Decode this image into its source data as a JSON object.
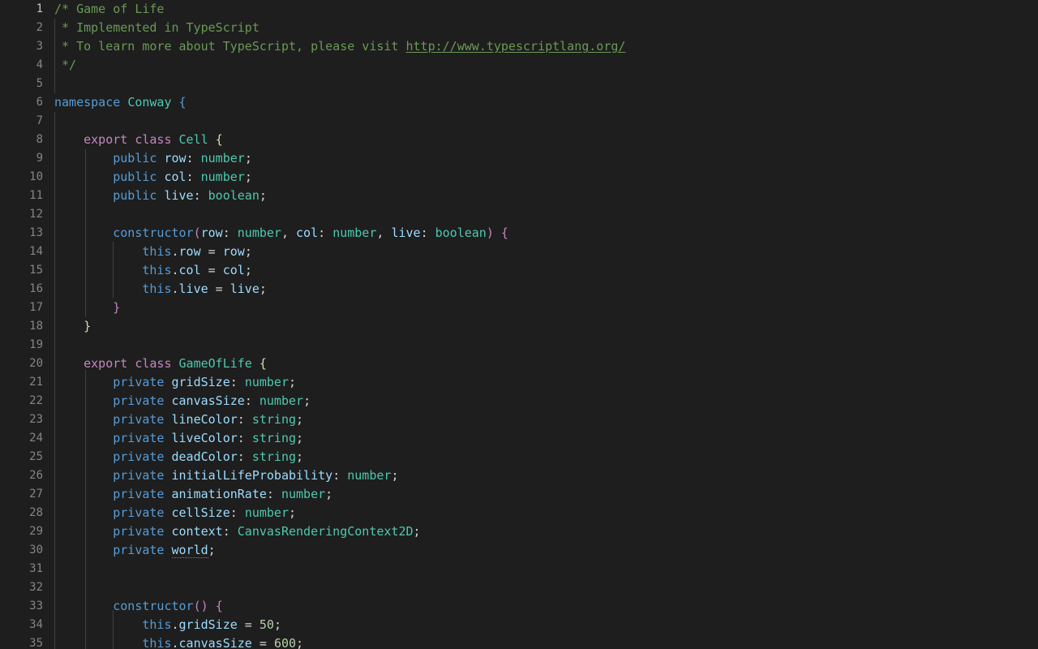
{
  "editor": {
    "language": "TypeScript",
    "background_color": "#1e1e1e",
    "line_number_color": "#858585",
    "active_line_number_color": "#c6c6c6",
    "indent_guide_color": "#404040",
    "active_line": 1,
    "first_visible_line": 1,
    "last_visible_line": 35,
    "line_height_px": 23,
    "font_size_px": 15
  },
  "palette": {
    "comment": "#6A9955",
    "keyword": "#C586C0",
    "control": "#569CD6",
    "type": "#4EC9B0",
    "variable": "#9CDCFE",
    "number": "#B5CEA8",
    "operator": "#d4d4d4",
    "bracket_level_1": "#569CD6",
    "bracket_level_2": "#DCDCAA",
    "bracket_level_3": "#C586C0"
  },
  "link": {
    "text": "http://www.typescriptlang.org/",
    "underlined": true
  },
  "hint": {
    "symbol": "world",
    "line": 30,
    "marker": "dotted-underline"
  },
  "lines": [
    {
      "n": 1,
      "text": "/* Game of Life"
    },
    {
      "n": 2,
      "text": " * Implemented in TypeScript"
    },
    {
      "n": 3,
      "text": " * To learn more about TypeScript, please visit http://www.typescriptlang.org/"
    },
    {
      "n": 4,
      "text": " */"
    },
    {
      "n": 5,
      "text": ""
    },
    {
      "n": 6,
      "text": "namespace Conway {"
    },
    {
      "n": 7,
      "text": ""
    },
    {
      "n": 8,
      "text": "    export class Cell {"
    },
    {
      "n": 9,
      "text": "        public row: number;"
    },
    {
      "n": 10,
      "text": "        public col: number;"
    },
    {
      "n": 11,
      "text": "        public live: boolean;"
    },
    {
      "n": 12,
      "text": ""
    },
    {
      "n": 13,
      "text": "        constructor(row: number, col: number, live: boolean) {"
    },
    {
      "n": 14,
      "text": "            this.row = row;"
    },
    {
      "n": 15,
      "text": "            this.col = col;"
    },
    {
      "n": 16,
      "text": "            this.live = live;"
    },
    {
      "n": 17,
      "text": "        }"
    },
    {
      "n": 18,
      "text": "    }"
    },
    {
      "n": 19,
      "text": ""
    },
    {
      "n": 20,
      "text": "    export class GameOfLife {"
    },
    {
      "n": 21,
      "text": "        private gridSize: number;"
    },
    {
      "n": 22,
      "text": "        private canvasSize: number;"
    },
    {
      "n": 23,
      "text": "        private lineColor: string;"
    },
    {
      "n": 24,
      "text": "        private liveColor: string;"
    },
    {
      "n": 25,
      "text": "        private deadColor: string;"
    },
    {
      "n": 26,
      "text": "        private initialLifeProbability: number;"
    },
    {
      "n": 27,
      "text": "        private animationRate: number;"
    },
    {
      "n": 28,
      "text": "        private cellSize: number;"
    },
    {
      "n": 29,
      "text": "        private context: CanvasRenderingContext2D;"
    },
    {
      "n": 30,
      "text": "        private world;"
    },
    {
      "n": 31,
      "text": ""
    },
    {
      "n": 32,
      "text": ""
    },
    {
      "n": 33,
      "text": "        constructor() {"
    },
    {
      "n": 34,
      "text": "            this.gridSize = 50;"
    },
    {
      "n": 35,
      "text": "            this.canvasSize = 600;"
    }
  ]
}
